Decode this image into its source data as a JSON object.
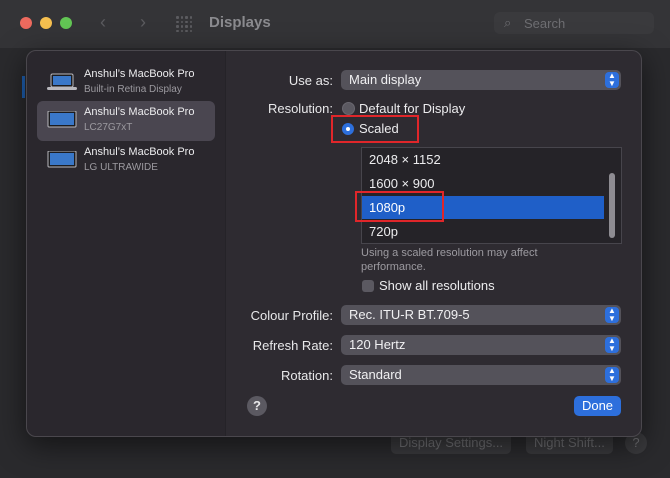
{
  "window": {
    "title": "Displays",
    "search_placeholder": "Search",
    "back_icon": "chevron-left-icon",
    "forward_icon": "chevron-right-icon",
    "grid_icon": "grid-icon"
  },
  "background_buttons": {
    "display_settings": "Display Settings...",
    "night_shift": "Night Shift...",
    "help": "?"
  },
  "displays": [
    {
      "name": "Anshul’s MacBook Pro",
      "subtitle": "Built-in Retina Display",
      "icon": "laptop-icon",
      "selected": false
    },
    {
      "name": "Anshul’s MacBook Pro",
      "subtitle": "LC27G7xT",
      "icon": "monitor-icon",
      "selected": true
    },
    {
      "name": "Anshul’s MacBook Pro",
      "subtitle": "LG ULTRAWIDE",
      "icon": "monitor-icon",
      "selected": false
    }
  ],
  "settings": {
    "use_as_label": "Use as:",
    "use_as_value": "Main display",
    "resolution_label": "Resolution:",
    "resolution_default": "Default for Display",
    "resolution_scaled": "Scaled",
    "resolution_selected": "Scaled",
    "resolutions": [
      "2048 × 1152",
      "1600 × 900",
      "1080p",
      "720p"
    ],
    "selected_resolution": "1080p",
    "scaled_note": "Using a scaled resolution may affect performance.",
    "show_all_label": "Show all resolutions",
    "show_all_checked": false,
    "colour_profile_label": "Colour Profile:",
    "colour_profile_value": "Rec. ITU-R BT.709-5",
    "refresh_rate_label": "Refresh Rate:",
    "refresh_rate_value": "120 Hertz",
    "rotation_label": "Rotation:",
    "rotation_value": "Standard"
  },
  "buttons": {
    "help": "?",
    "done": "Done"
  },
  "colors": {
    "accent": "#2d6fdc",
    "highlight_box": "#e0262a",
    "selected_row": "#1f5fc8"
  }
}
